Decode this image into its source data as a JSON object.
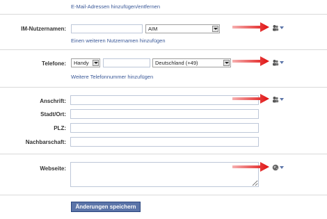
{
  "email": {
    "link": "E-Mail-Adressen hinzufügen/entfernen"
  },
  "im": {
    "label": "IM-Nutzernamen:",
    "username_value": "",
    "service_selected": "AIM",
    "add_link": "Einen weiteren Nutzernamen hinzufügen"
  },
  "phone": {
    "label": "Telefone:",
    "type_selected": "Handy",
    "number_value": "",
    "country_selected": "Deutschland (+49)",
    "add_link": "Weitere Telefonnummer hinzufügen"
  },
  "address": {
    "street_label": "Anschrift:",
    "city_label": "Stadt/Ort:",
    "zip_label": "PLZ:",
    "neighborhood_label": "Nachbarschaft:",
    "street_value": "",
    "city_value": "",
    "zip_value": "",
    "neighborhood_value": ""
  },
  "website": {
    "label": "Webseite:",
    "value": ""
  },
  "actions": {
    "save_label": "Änderungen speichern"
  },
  "colors": {
    "link": "#3b5998",
    "button": "#5b74a8",
    "arrow": "#e02020"
  },
  "icons": {
    "privacy_friends": "friends-icon",
    "privacy_everyone": "globe-icon",
    "annotation_arrow": "red-arrow-icon"
  }
}
